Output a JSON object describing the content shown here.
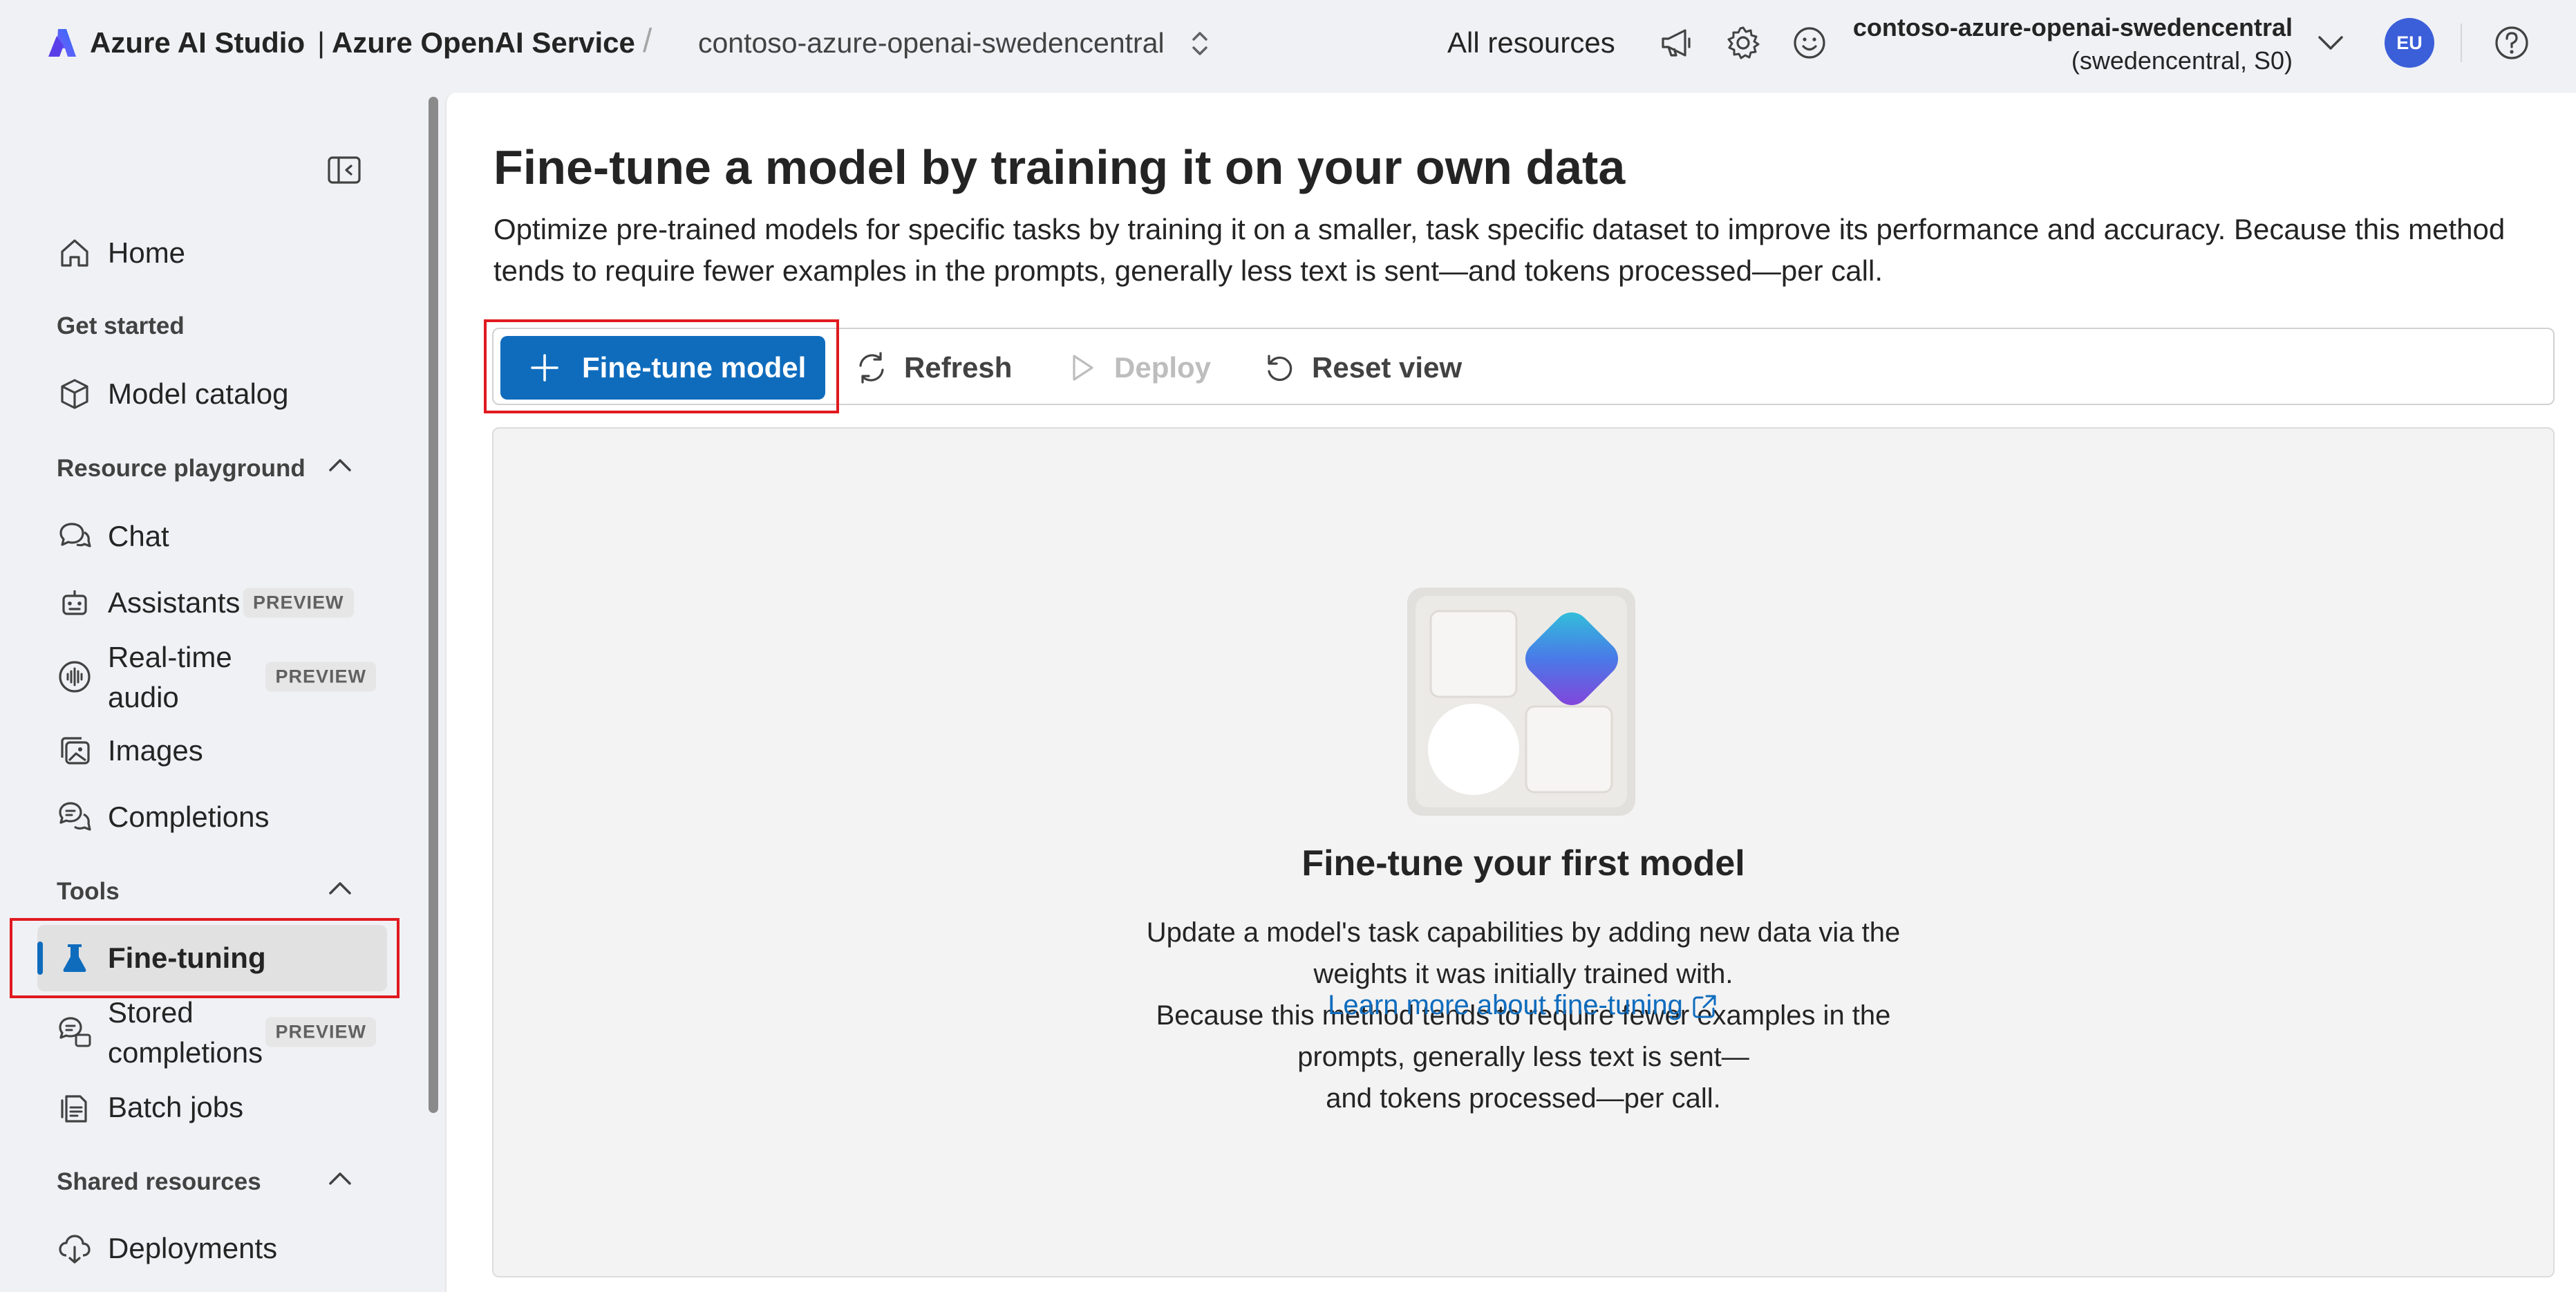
{
  "header": {
    "app_name": "Azure AI Studio",
    "service_name": "Azure OpenAI Service",
    "resource_name": "contoso-azure-openai-swedencentral",
    "all_resources_label": "All resources",
    "account": {
      "name": "contoso-azure-openai-swedencentral",
      "region_tier": "(swedencentral, S0)",
      "initials": "EU"
    }
  },
  "sidebar": {
    "home_label": "Home",
    "sections": {
      "get_started": "Get started",
      "resource_playground": "Resource playground",
      "tools": "Tools",
      "shared_resources": "Shared resources"
    },
    "items": {
      "model_catalog": "Model catalog",
      "chat": "Chat",
      "assistants": "Assistants",
      "realtime_audio_line1": "Real-time",
      "realtime_audio_line2": "audio",
      "images": "Images",
      "completions": "Completions",
      "fine_tuning": "Fine-tuning",
      "stored_completions_line1": "Stored",
      "stored_completions_line2": "completions",
      "batch_jobs": "Batch jobs",
      "deployments": "Deployments"
    },
    "preview_badge": "PREVIEW",
    "active_item": "Fine-tuning"
  },
  "main": {
    "title": "Fine-tune a model by training it on your own data",
    "description": "Optimize pre-trained models for specific tasks by training it on a smaller, task specific dataset to improve its performance and accuracy. Because this method tends to require fewer examples in the prompts, generally less text is sent—and tokens processed—per call.",
    "toolbar": {
      "fine_tune_label": "Fine-tune model",
      "refresh_label": "Refresh",
      "deploy_label": "Deploy",
      "reset_label": "Reset view"
    },
    "empty_state": {
      "title": "Fine-tune your first model",
      "description_line1": "Update a model's task capabilities by adding new data via the weights it was initially trained with.",
      "description_line2": "Because this method tends to require fewer examples in the prompts, generally less text is sent—",
      "description_line3": "and tokens processed—per call.",
      "link_label": "Learn more about fine-tuning"
    }
  },
  "colors": {
    "accent": "#0f6cbd",
    "highlight": "#e0191f",
    "avatar": "#3b5fd9"
  }
}
